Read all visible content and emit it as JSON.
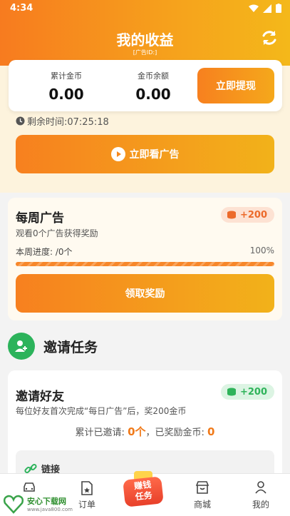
{
  "status_bar": {
    "time": "4:34"
  },
  "header": {
    "title": "我的收益",
    "subtitle": "[广告ID:]"
  },
  "summary": {
    "total_coins_label": "累计金币",
    "total_coins_value": "0.00",
    "balance_label": "金币余额",
    "balance_value": "0.00",
    "withdraw_label": "立即提现"
  },
  "daily_ad": {
    "remaining_time": "剩余时间:07:25:18",
    "watch_button_label": "立即看广告"
  },
  "weekly_ad": {
    "title": "每周广告",
    "reward_badge": "+200",
    "description": "观看0个广告获得奖励",
    "progress_label": "本周进度: /0个",
    "progress_percent_text": "100%",
    "progress_fraction": 1.0,
    "claim_button_label": "领取奖励"
  },
  "invite_section": {
    "heading": "邀请任务"
  },
  "invite_card": {
    "title": "邀请好友",
    "reward_badge": "+200",
    "description": "每位好友首次完成“每日广告”后，奖200金币",
    "invited_prefix": "累计已邀请: ",
    "invited_count": "0个",
    "rewarded_prefix": "，已奖励金币: ",
    "rewarded_count": "0",
    "link_label": "链接"
  },
  "tabbar": {
    "tab1_label": "",
    "orders_label": "订单",
    "center_line1": "赚钱",
    "center_line2": "任务",
    "mall_label": "商城",
    "mine_label": "我的"
  },
  "watermark": {
    "name": "安心下载网",
    "url": "www.java800.com"
  },
  "colors": {
    "accent_orange": "#f7801f",
    "accent_yellow": "#f2b21a",
    "green": "#2cb35b"
  }
}
